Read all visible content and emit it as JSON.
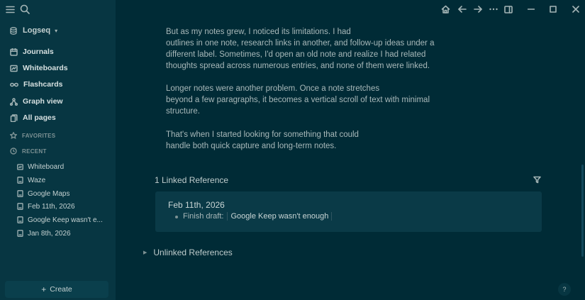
{
  "sidebar": {
    "graph_name": "Logseq",
    "nav": [
      {
        "label": "Journals"
      },
      {
        "label": "Whiteboards"
      },
      {
        "label": "Flashcards"
      },
      {
        "label": "Graph view"
      },
      {
        "label": "All pages"
      }
    ],
    "favorites_label": "FAVORITES",
    "recent_label": "RECENT",
    "recent": [
      {
        "label": "Whiteboard",
        "icon": "whiteboard-icon"
      },
      {
        "label": "Waze",
        "icon": "page-icon"
      },
      {
        "label": "Google Maps",
        "icon": "page-icon"
      },
      {
        "label": "Feb 11th, 2026",
        "icon": "page-icon"
      },
      {
        "label": "Google Keep wasn't e...",
        "icon": "page-icon"
      },
      {
        "label": "Jan 8th, 2026",
        "icon": "page-icon"
      }
    ],
    "create_label": "Create"
  },
  "content": {
    "paragraphs": [
      [
        "But as my notes grew, I noticed its limitations. I had",
        "outlines in one note, research links in another, and follow-up ideas under a",
        "different label. Sometimes, I'd open an old note and realize I had related",
        "thoughts spread across numerous entries, and none of them were linked."
      ],
      [
        "Longer notes were another problem. Once a note stretches",
        "beyond a few paragraphs, it becomes a vertical scroll of text with minimal",
        "structure."
      ],
      [
        "That's when I started looking for something that could",
        "handle both quick capture and long-term notes."
      ]
    ],
    "linked_title": "1 Linked Reference",
    "ref_date": "Feb 11th, 2026",
    "ref_prefix": "Finish draft:",
    "ref_page": "Google Keep wasn't enough",
    "unlinked_title": "Unlinked References",
    "help": "?"
  },
  "colors": {
    "bg": "#002b36",
    "sidebar": "#073642",
    "text": "#a4b5b6"
  }
}
